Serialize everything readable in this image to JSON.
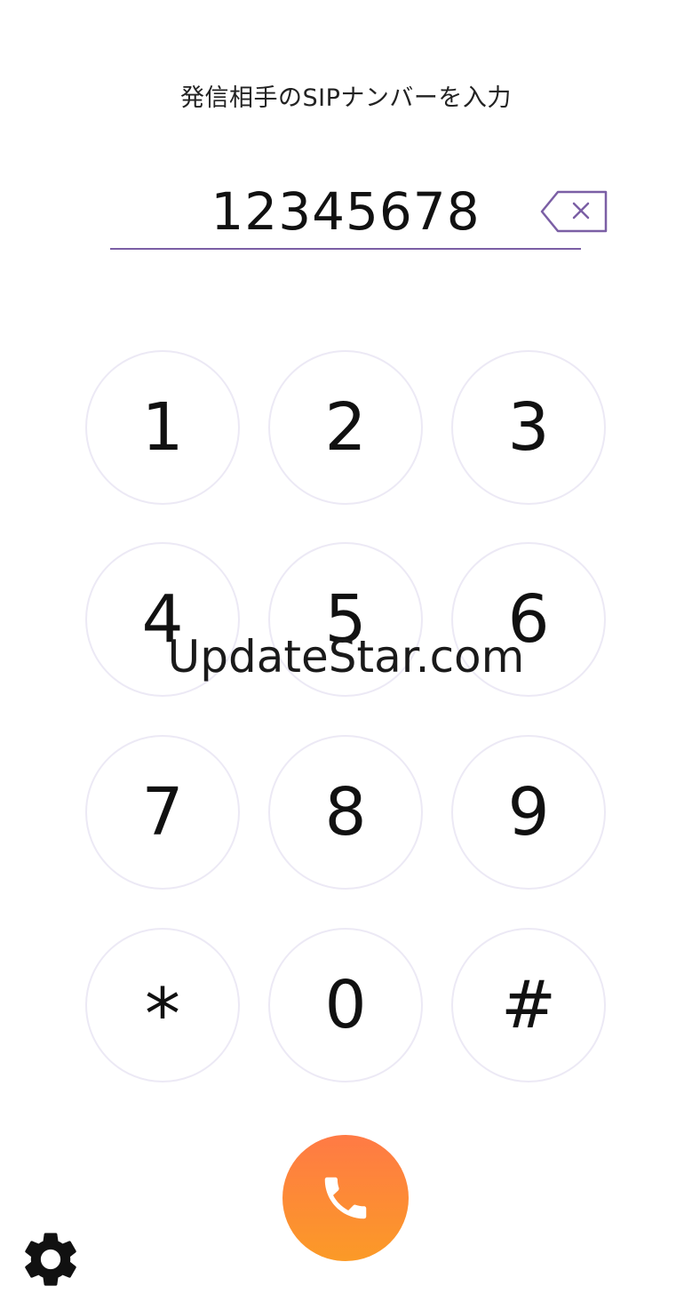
{
  "header": {
    "prompt": "発信相手のSIPナンバーを入力"
  },
  "input": {
    "value": "12345678"
  },
  "keypad": {
    "keys": [
      "1",
      "2",
      "3",
      "4",
      "5",
      "6",
      "7",
      "8",
      "9",
      "*",
      "0",
      "#"
    ]
  },
  "watermark": {
    "text": "UpdateStar.com"
  },
  "icons": {
    "backspace": "backspace-icon",
    "call": "phone-icon",
    "settings": "gear-icon"
  },
  "colors": {
    "accent": "#7b5fa5",
    "call_gradient_top": "#ff7a45",
    "call_gradient_bottom": "#fb9a27",
    "key_border": "#ece9f5"
  }
}
